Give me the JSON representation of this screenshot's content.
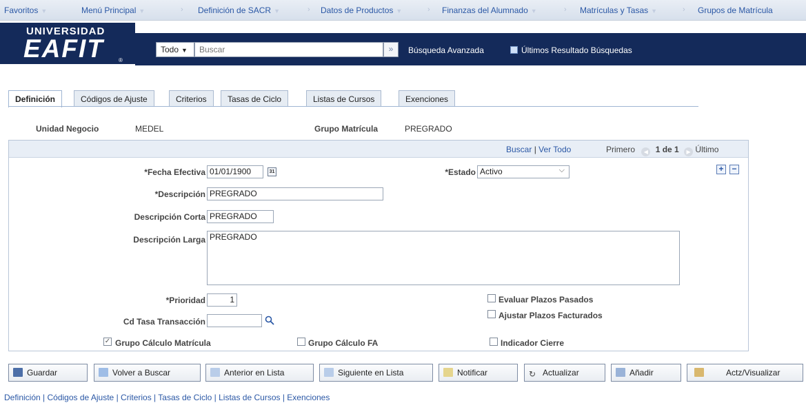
{
  "topnav": {
    "items": [
      "Favoritos",
      "Menú Principal",
      "Definición de SACR",
      "Datos de Productos",
      "Finanzas del Alumnado",
      "Matrículas y Tasas",
      "Grupos de Matrícula"
    ]
  },
  "header": {
    "logo_top": "UNIVERSIDAD",
    "logo_main": "EAFIT",
    "logo_reg": "®",
    "scope": "Todo",
    "search_placeholder": "Buscar",
    "search_go": "»",
    "advanced": "Búsqueda Avanzada",
    "recent": "Últimos Resultado Búsquedas"
  },
  "tabs": [
    {
      "label": "Definición",
      "active": true
    },
    {
      "label": "Códigos de Ajuste"
    },
    {
      "label": "Criterios"
    },
    {
      "label": "Tasas de Ciclo"
    },
    {
      "label": "Listas de Cursos"
    },
    {
      "label": "Exenciones"
    }
  ],
  "keys": {
    "unit_label": "Unidad Negocio",
    "unit_value": "MEDEL",
    "group_label": "Grupo Matrícula",
    "group_value": "PREGRADO"
  },
  "grid_nav": {
    "find": "Buscar",
    "sep": "|",
    "view_all": "Ver Todo",
    "first": "Primero",
    "range": "1 de 1",
    "last": "Último"
  },
  "form": {
    "eff_date_label": "*Fecha Efectiva",
    "eff_date_value": "01/01/1900",
    "status_label": "*Estado",
    "status_value": "Activo",
    "desc_label": "*Descripción",
    "desc_value": "PREGRADO",
    "short_desc_label": "Descripción Corta",
    "short_desc_value": "PREGRADO",
    "long_desc_label": "Descripción Larga",
    "long_desc_value": "PREGRADO",
    "priority_label": "*Prioridad",
    "priority_value": "1",
    "tx_rate_label": "Cd Tasa Transacción",
    "tx_rate_value": "",
    "eval_past": {
      "label": "Evaluar Plazos Pasados",
      "checked": false
    },
    "adjust_billed": {
      "label": "Ajustar Plazos Facturados",
      "checked": false
    },
    "calc_group": {
      "label": "Grupo Cálculo Matrícula",
      "checked": true
    },
    "fa_group": {
      "label": "Grupo Cálculo FA",
      "checked": false
    },
    "close_ind": {
      "label": "Indicador Cierre",
      "checked": false
    }
  },
  "buttons": {
    "save": "Guardar",
    "return_search": "Volver a Buscar",
    "prev": "Anterior en Lista",
    "next": "Siguiente en Lista",
    "notify": "Notificar",
    "refresh": "Actualizar",
    "add": "Añadir",
    "update_display": "Actz/Visualizar"
  },
  "footer_links": [
    "Definición",
    "Códigos de Ajuste",
    "Criterios",
    "Tasas de Ciclo",
    "Listas de Cursos",
    "Exenciones"
  ],
  "colors": {
    "brand": "#142a5a",
    "link": "#2a57a5"
  }
}
